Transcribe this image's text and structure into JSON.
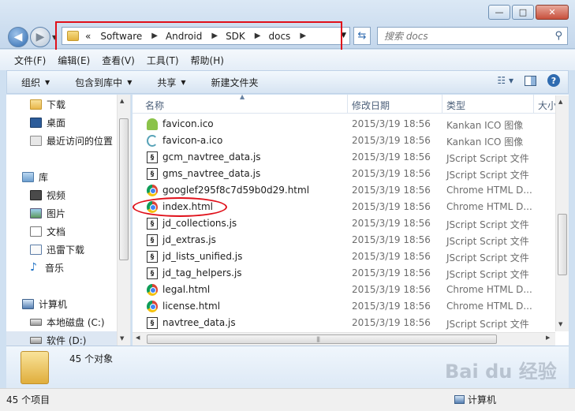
{
  "window": {
    "buttons": {
      "minimize": "—",
      "maximize": "□",
      "close": "✕"
    }
  },
  "address": {
    "overflow": "«",
    "crumbs": [
      "Software",
      "Android",
      "SDK",
      "docs"
    ],
    "search_placeholder": "搜索 docs"
  },
  "menubar": {
    "items": [
      "文件(F)",
      "编辑(E)",
      "查看(V)",
      "工具(T)",
      "帮助(H)"
    ]
  },
  "toolbar": {
    "organize": "组织",
    "include_library": "包含到库中",
    "share": "共享",
    "new_folder": "新建文件夹"
  },
  "sidebar": {
    "items": [
      {
        "label": "下载",
        "icon": "download-folder-icon"
      },
      {
        "label": "桌面",
        "icon": "desktop-icon"
      },
      {
        "label": "最近访问的位置",
        "icon": "recent-places-icon"
      },
      {
        "label": "库",
        "icon": "library-icon"
      },
      {
        "label": "视频",
        "icon": "video-library-icon"
      },
      {
        "label": "图片",
        "icon": "pictures-library-icon"
      },
      {
        "label": "文档",
        "icon": "documents-library-icon"
      },
      {
        "label": "迅雷下载",
        "icon": "xunlei-downloads-icon"
      },
      {
        "label": "音乐",
        "icon": "music-library-icon"
      },
      {
        "label": "计算机",
        "icon": "computer-icon"
      },
      {
        "label": "本地磁盘 (C:)",
        "icon": "local-disk-icon"
      },
      {
        "label": "软件 (D:)",
        "icon": "drive-icon"
      }
    ]
  },
  "columns": {
    "name": "名称",
    "date": "修改日期",
    "type": "类型",
    "size": "大小"
  },
  "files": [
    {
      "name": "favicon.ico",
      "date": "2015/3/19 18:56",
      "type": "Kankan ICO 图像",
      "icon": "android-ico-icon"
    },
    {
      "name": "favicon-a.ico",
      "date": "2015/3/19 18:56",
      "type": "Kankan ICO 图像",
      "icon": "kankan-ico-icon"
    },
    {
      "name": "gcm_navtree_data.js",
      "date": "2015/3/19 18:56",
      "type": "JScript Script 文件",
      "icon": "jscript-file-icon"
    },
    {
      "name": "gms_navtree_data.js",
      "date": "2015/3/19 18:56",
      "type": "JScript Script 文件",
      "icon": "jscript-file-icon"
    },
    {
      "name": "googlef295f8c7d59b0d29.html",
      "date": "2015/3/19 18:56",
      "type": "Chrome HTML D...",
      "icon": "chrome-html-icon"
    },
    {
      "name": "index.html",
      "date": "2015/3/19 18:56",
      "type": "Chrome HTML D...",
      "icon": "chrome-html-icon"
    },
    {
      "name": "jd_collections.js",
      "date": "2015/3/19 18:56",
      "type": "JScript Script 文件",
      "icon": "jscript-file-icon"
    },
    {
      "name": "jd_extras.js",
      "date": "2015/3/19 18:56",
      "type": "JScript Script 文件",
      "icon": "jscript-file-icon"
    },
    {
      "name": "jd_lists_unified.js",
      "date": "2015/3/19 18:56",
      "type": "JScript Script 文件",
      "icon": "jscript-file-icon"
    },
    {
      "name": "jd_tag_helpers.js",
      "date": "2015/3/19 18:56",
      "type": "JScript Script 文件",
      "icon": "jscript-file-icon"
    },
    {
      "name": "legal.html",
      "date": "2015/3/19 18:56",
      "type": "Chrome HTML D...",
      "icon": "chrome-html-icon"
    },
    {
      "name": "license.html",
      "date": "2015/3/19 18:56",
      "type": "Chrome HTML D...",
      "icon": "chrome-html-icon"
    },
    {
      "name": "navtree_data.js",
      "date": "2015/3/19 18:56",
      "type": "JScript Script 文件",
      "icon": "jscript-file-icon"
    }
  ],
  "details": {
    "count": "45 个对象"
  },
  "status": {
    "items": "45 个项目",
    "location": "计算机"
  },
  "watermark": "Bai du 经验",
  "colors": {
    "annotation_red": "#e0101a",
    "accent_blue": "#2f6bb0"
  }
}
